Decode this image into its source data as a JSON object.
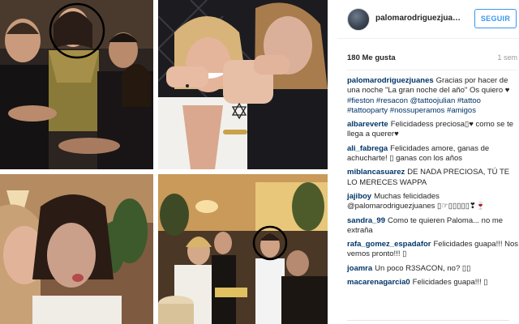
{
  "post": {
    "username": "palomarodriguezjuanes",
    "follow_label": "SEGUIR",
    "likes": "180 Me gusta",
    "time_ago": "1 sem"
  },
  "comments": [
    {
      "user": "palomarodriguezjuanes",
      "text": "Gracias por hacer de una noche \"La gran noche del año\" Os quiero ♥ ",
      "tags": "#fieston #resacon @tattoojulian #tattoo #tattooparty #nossuperamos #amigos"
    },
    {
      "user": "albareverte",
      "text": "Felicidadess preciosa▯♥ como se te llega a querer♥"
    },
    {
      "user": "ali_fabrega",
      "text": "Felicidades amore, ganas de achucharte! ▯ ganas con los años"
    },
    {
      "user": "miblancasuarez",
      "text": "DE NADA PRECIOSA, TÚ TE LO MERECES WAPPA"
    },
    {
      "user": "jajiboy",
      "text": "Muchas felicidades @palomarodriguezjuanes ▯☞▯▯▯▯▯❣🍷"
    },
    {
      "user": "sandra_99",
      "text": "Como te quieren Paloma... no me extraña"
    },
    {
      "user": "rafa_gomez_espadafor",
      "text": "Felicidades guapa!!! Nos vemos pronto!!! ▯"
    },
    {
      "user": "joamra",
      "text": "Un poco R3SACON, no? ▯▯"
    },
    {
      "user": "macarenagarcia0",
      "text": "Felicidades guapa!!! ▯"
    }
  ],
  "icons": {
    "avatar": "profile-avatar",
    "photos": [
      "party-group-photo",
      "tattoo-wrists-photo",
      "selfie-kiss-photo",
      "birthday-cake-photo"
    ]
  },
  "colors": {
    "link": "#003569",
    "follow": "#3897f0",
    "muted": "#999999"
  }
}
